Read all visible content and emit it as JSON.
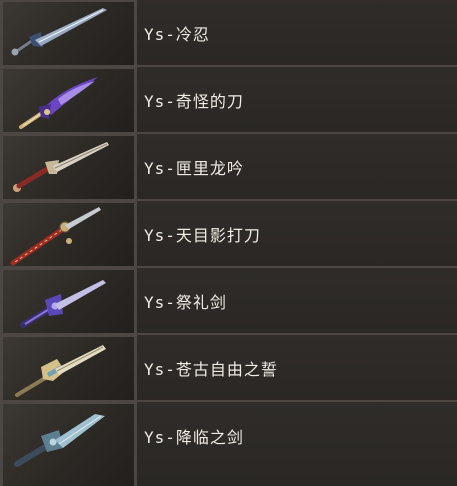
{
  "weapons": [
    {
      "name": "Ys-冷忍",
      "icon": "sword-icon",
      "color": "#8fa7c9"
    },
    {
      "name": "Ys-奇怪的刀",
      "icon": "sword-icon",
      "color": "#7a5bc9"
    },
    {
      "name": "Ys-匣里龙吟",
      "icon": "sword-icon",
      "color": "#c9a27a"
    },
    {
      "name": "Ys-天目影打刀",
      "icon": "sword-icon",
      "color": "#b8533d"
    },
    {
      "name": "Ys-祭礼剑",
      "icon": "sword-icon",
      "color": "#6a58c9"
    },
    {
      "name": "Ys-苍古自由之誓",
      "icon": "sword-icon",
      "color": "#cbb37a"
    },
    {
      "name": "Ys-降临之剑",
      "icon": "sword-icon",
      "color": "#7fa4b6"
    }
  ]
}
